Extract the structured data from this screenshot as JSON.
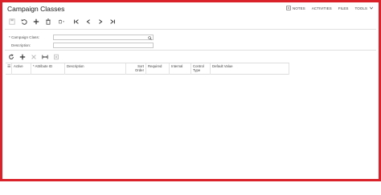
{
  "screen": {
    "title": "Campaign Classes"
  },
  "topnav": {
    "notes": "NOTES",
    "activities": "ACTIVITIES",
    "files": "FILES",
    "tools": "TOOLS"
  },
  "toolbar": {
    "icons": [
      "save-icon",
      "undo-icon",
      "add-icon",
      "delete-icon",
      "copy-paste-icon",
      "first-icon",
      "previous-icon",
      "next-icon",
      "last-icon"
    ]
  },
  "form": {
    "campaign_class_label": "* Campaign Class:",
    "campaign_class_value": "",
    "description_label": "Description:",
    "description_value": ""
  },
  "grid": {
    "columns": [
      "",
      "Active",
      "* Attribute ID",
      "Description",
      "Sort\nOrder",
      "Required",
      "Internal",
      "Control\nType",
      "Default Value"
    ],
    "rows": []
  }
}
